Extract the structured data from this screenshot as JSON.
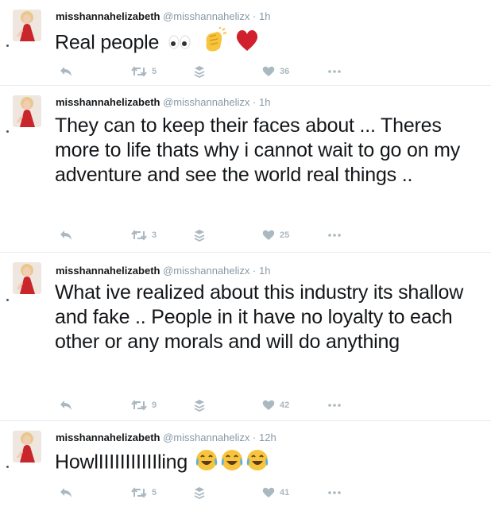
{
  "tweets": [
    {
      "name": "misshannahelizabeth",
      "handle": "@misshannahelizx",
      "separator": "·",
      "time": "1h",
      "text": "Real people",
      "emojis": [
        "eyes",
        "clapping-hands",
        "red-heart"
      ],
      "retweets": "5",
      "likes": "36"
    },
    {
      "name": "misshannahelizabeth",
      "handle": "@misshannahelizx",
      "separator": "·",
      "time": "1h",
      "text": "They can to keep their faces about ... Theres more to life thats why i cannot wait to go on my adventure and see the world real things ..",
      "emojis": [],
      "retweets": "3",
      "likes": "25"
    },
    {
      "name": "misshannahelizabeth",
      "handle": "@misshannahelizx",
      "separator": "·",
      "time": "1h",
      "text": "What ive realized about this industry its shallow and fake .. People in it have no loyalty to each other or any morals and will do anything",
      "emojis": [],
      "retweets": "9",
      "likes": "42"
    },
    {
      "name": "misshannahelizabeth",
      "handle": "@misshannahelizx",
      "separator": "·",
      "time": "12h",
      "text": "HowlIIIIIIIIIIIling",
      "emojis": [
        "face-with-tears-of-joy",
        "face-with-tears-of-joy",
        "face-with-tears-of-joy"
      ],
      "retweets": "5",
      "likes": "41"
    }
  ],
  "icons": {
    "reply": "reply-icon",
    "retweet": "retweet-icon",
    "stack": "stack-icon",
    "like": "heart-icon",
    "more": "more-icon"
  },
  "colors": {
    "icon_gray": "#aab8c2",
    "handle_gray": "#8899a6",
    "divider": "#e6ecf0"
  }
}
